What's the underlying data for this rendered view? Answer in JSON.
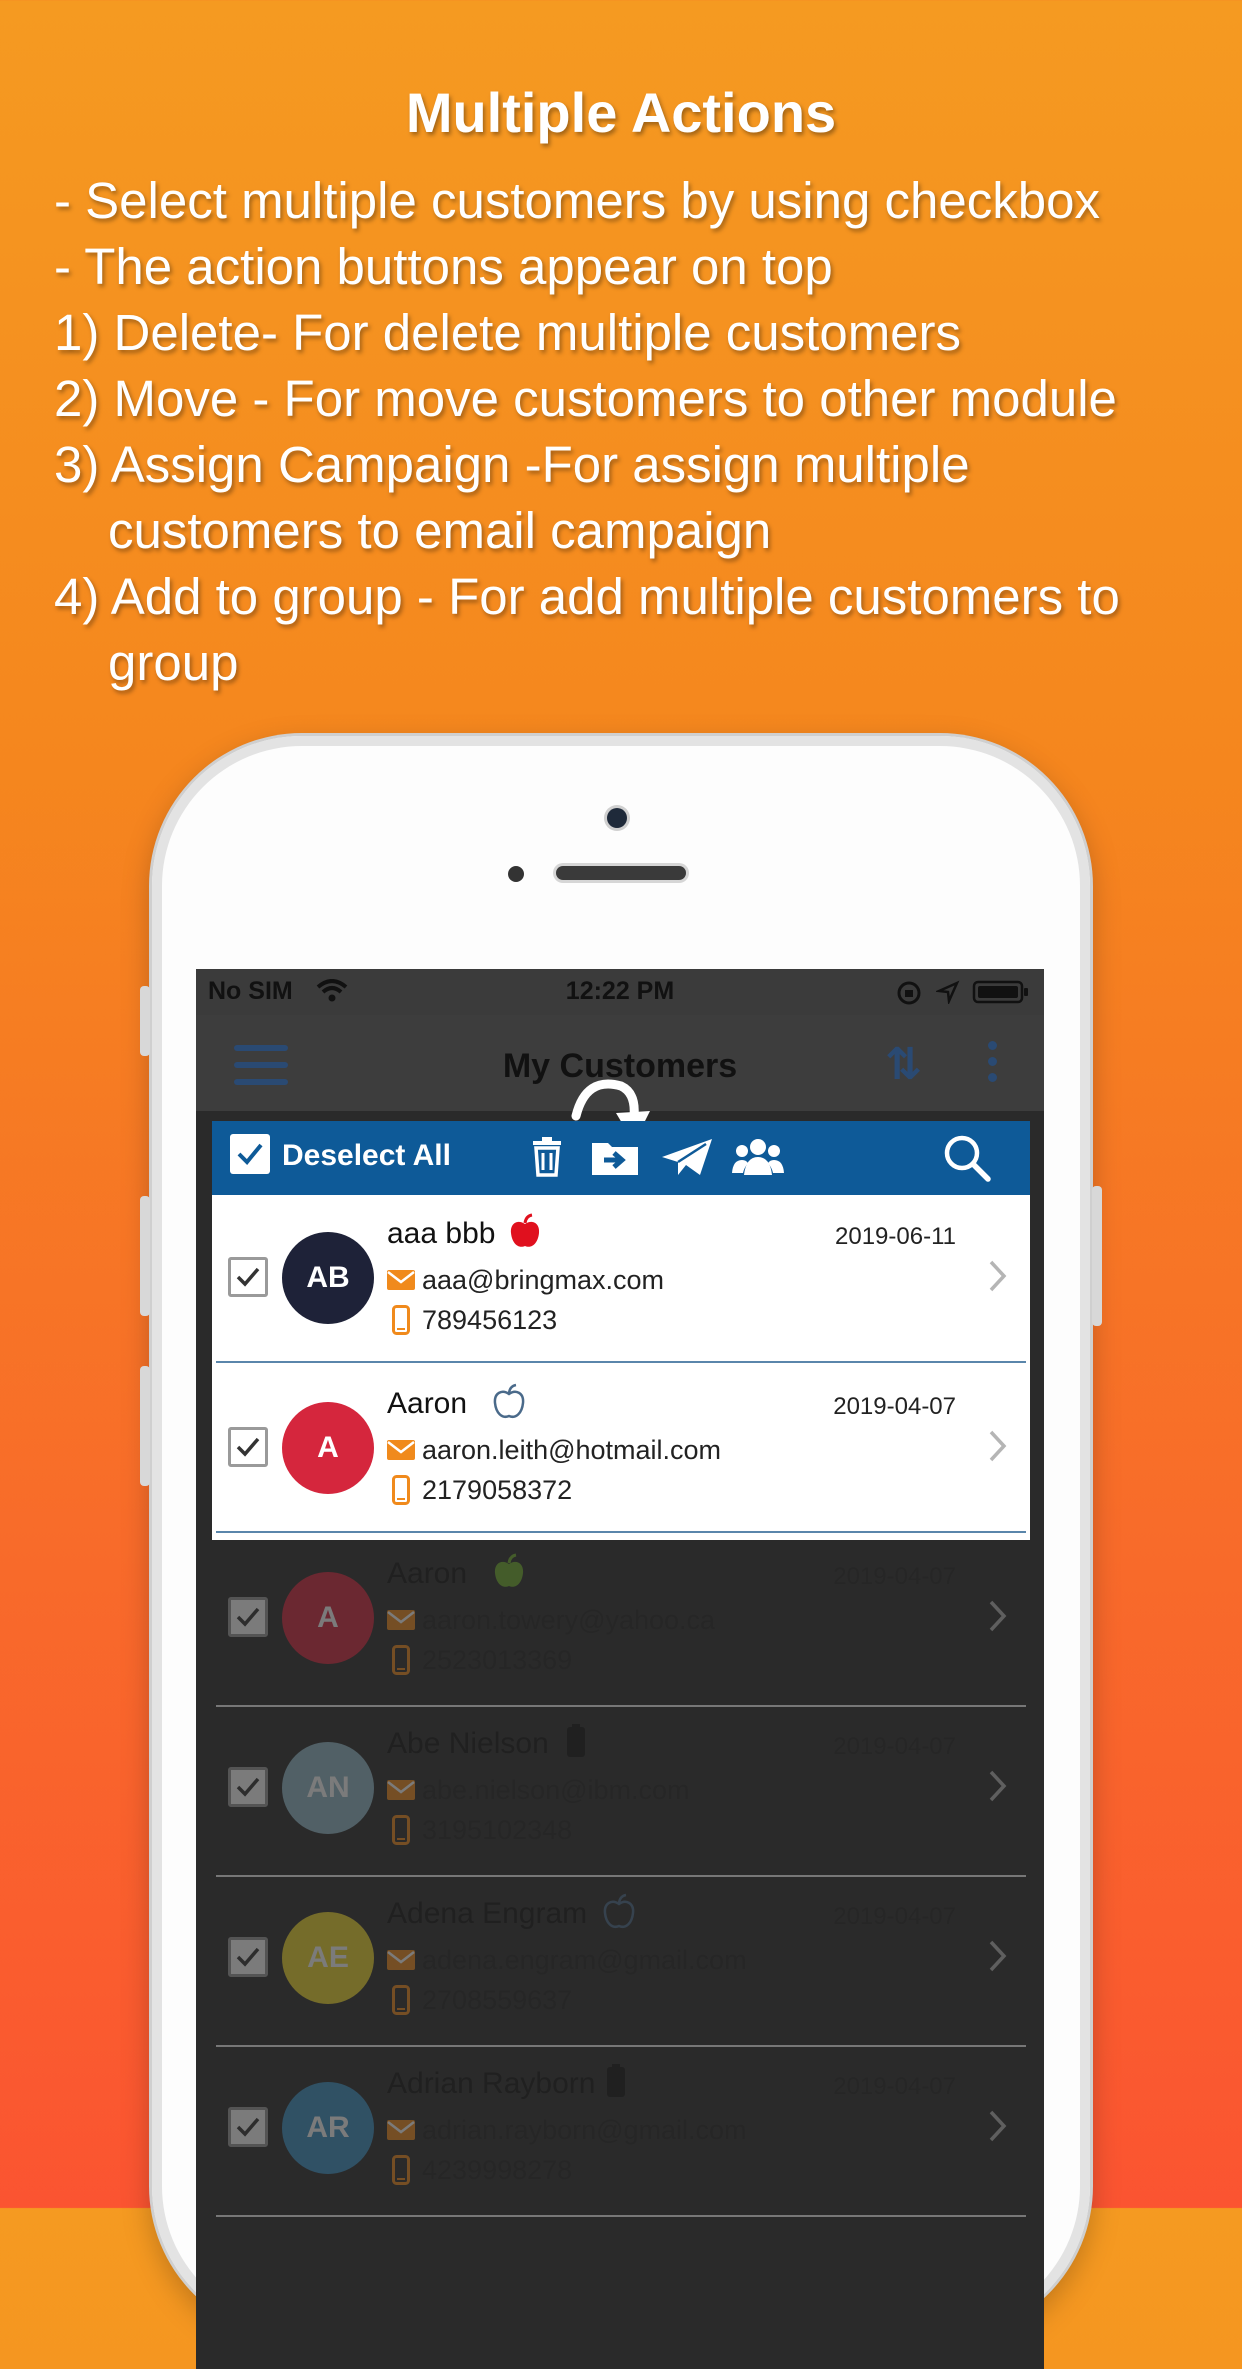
{
  "promo": {
    "title": "Multiple Actions",
    "lines": [
      "- Select multiple customers by using checkbox",
      "- The action buttons appear on top",
      "1) Delete- For delete multiple customers",
      "2) Move - For move customers to other module",
      "3) Assign Campaign -For assign multiple",
      "customers to email campaign",
      "4) Add to group - For add multiple customers to",
      "group"
    ]
  },
  "status": {
    "carrier": "No SIM",
    "time": "12:22 PM"
  },
  "app": {
    "title": "My Customers",
    "deselect_label": "Deselect All"
  },
  "colors": {
    "accent": "#0e5a98",
    "nav": "#2a4a73",
    "mail": "#f08a1c"
  },
  "icons": {
    "menu": "hamburger-icon",
    "sort": "sort-arrows-icon",
    "more": "kebab-icon",
    "delete": "trash-icon",
    "move": "folder-move-icon",
    "campaign": "paper-plane-icon",
    "group": "group-icon",
    "search": "search-icon"
  },
  "customers": [
    {
      "initials": "AB",
      "name": "aaa bbb",
      "email": "aaa@bringmax.com",
      "phone": "789456123",
      "date": "2019-06-11",
      "avatar_color": "#1e2238",
      "platform": "apple-red"
    },
    {
      "initials": "A",
      "name": "Aaron",
      "email": "aaron.leith@hotmail.com",
      "phone": "2179058372",
      "date": "2019-04-07",
      "avatar_color": "#d5263d",
      "platform": "apple-outline"
    },
    {
      "initials": "A",
      "name": "Aaron",
      "email": "aaron.towery@yahoo.ca",
      "phone": "2523013369",
      "date": "2019-04-07",
      "avatar_color": "#d5263d",
      "platform": "apple-green"
    },
    {
      "initials": "AN",
      "name": "Abe Nielson",
      "email": "abe.nielson@ibm.com",
      "phone": "3195102348",
      "date": "2019-04-07",
      "avatar_color": "#90b8c9",
      "platform": "phone-black"
    },
    {
      "initials": "AE",
      "name": "Adena Engram",
      "email": "adena.engram@gmail.com",
      "phone": "2708559637",
      "date": "2019-04-07",
      "avatar_color": "#f0d72a",
      "platform": "apple-outline"
    },
    {
      "initials": "AR",
      "name": "Adrian Rayborn",
      "email": "adrian.rayborn@gmail.com",
      "phone": "4239998278",
      "date": "2019-04-07",
      "avatar_color": "#3b91c4",
      "platform": "phone-black"
    }
  ]
}
